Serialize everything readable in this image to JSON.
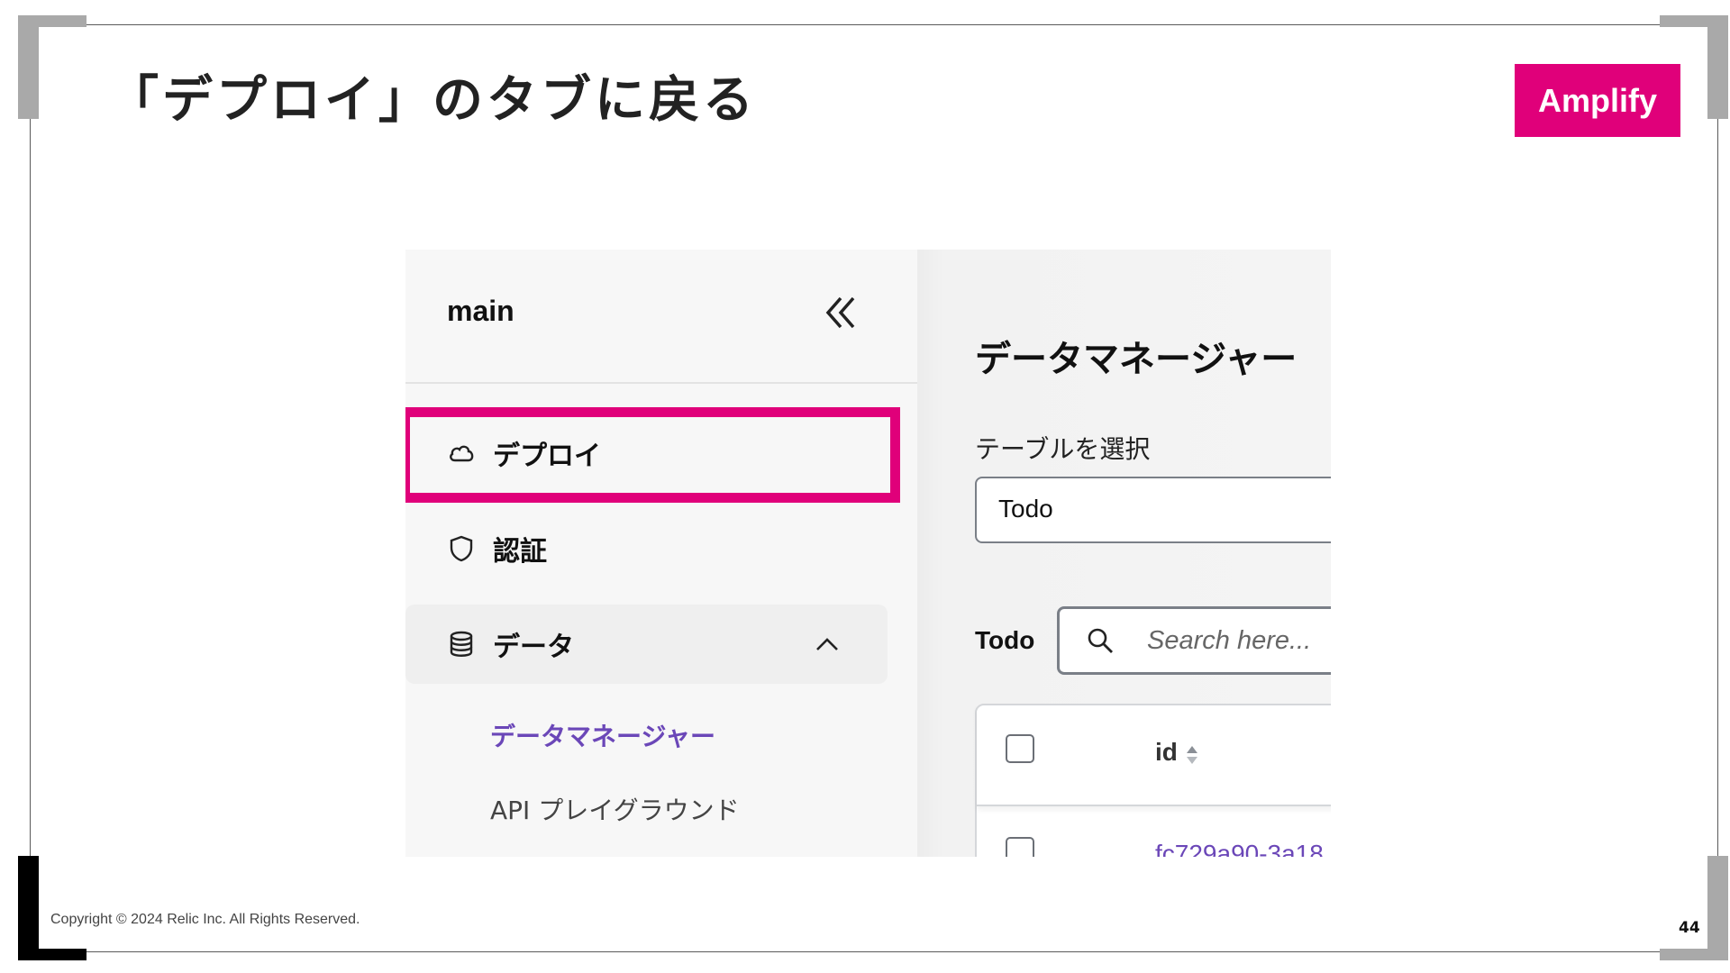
{
  "slide": {
    "title": "「デプロイ」のタブに戻る",
    "badge": "Amplify",
    "copyright": "Copyright © 2024 Relic Inc. All Rights Reserved.",
    "page_number": "44"
  },
  "sidebar": {
    "branch": "main",
    "items": [
      {
        "label": "デプロイ",
        "icon": "cloud-icon"
      },
      {
        "label": "認証",
        "icon": "shield-icon"
      },
      {
        "label": "データ",
        "icon": "database-icon",
        "expanded": true
      }
    ],
    "sub_items": [
      {
        "label": "データマネージャー",
        "active": true
      },
      {
        "label": "API プレイグラウンド",
        "active": false
      }
    ]
  },
  "main": {
    "title": "データマネージャー",
    "table_select_label": "テーブルを選択",
    "table_select_value": "Todo",
    "table_name": "Todo",
    "search_placeholder": "Search here...",
    "columns": [
      "id"
    ],
    "rows": [
      {
        "id": "fc729a90-3a18"
      }
    ]
  },
  "colors": {
    "accent": "#e0007a",
    "link_purple": "#6b47b8"
  }
}
